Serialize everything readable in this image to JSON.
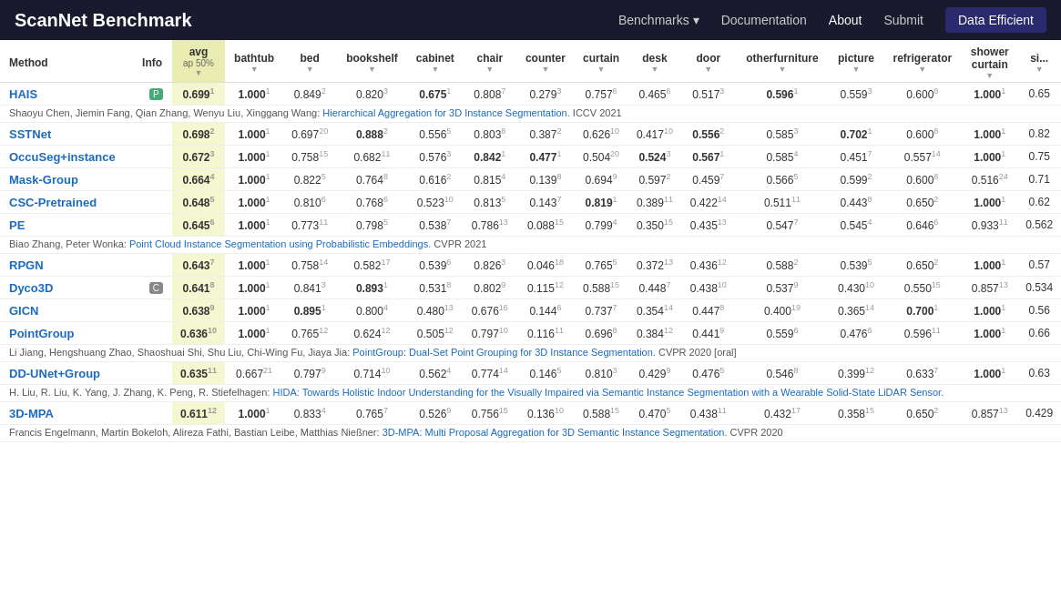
{
  "nav": {
    "title": "ScanNet Benchmark",
    "links": [
      {
        "label": "Benchmarks",
        "has_dropdown": true
      },
      {
        "label": "Documentation"
      },
      {
        "label": "About",
        "active": true
      },
      {
        "label": "Submit"
      },
      {
        "label": "Data Efficient",
        "special": true
      }
    ]
  },
  "table": {
    "columns": [
      {
        "key": "method",
        "label": "Method"
      },
      {
        "key": "info",
        "label": "Info"
      },
      {
        "key": "avg",
        "label": "avg",
        "sub": "ap 50%"
      },
      {
        "key": "bathtub",
        "label": "bathtub"
      },
      {
        "key": "bed",
        "label": "bed"
      },
      {
        "key": "bookshelf",
        "label": "bookshelf"
      },
      {
        "key": "cabinet",
        "label": "cabinet"
      },
      {
        "key": "chair",
        "label": "chair"
      },
      {
        "key": "counter",
        "label": "counter"
      },
      {
        "key": "curtain",
        "label": "curtain"
      },
      {
        "key": "desk",
        "label": "desk"
      },
      {
        "key": "door",
        "label": "door"
      },
      {
        "key": "otherfurniture",
        "label": "otherfurniture"
      },
      {
        "key": "picture",
        "label": "picture"
      },
      {
        "key": "refrigerator",
        "label": "refrigerator"
      },
      {
        "key": "shower_curtain",
        "label": "shower curtain"
      },
      {
        "key": "sink",
        "label": "si..."
      }
    ],
    "rows": [
      {
        "type": "data",
        "method": "HAIS",
        "badge": "P",
        "avg": "0.699",
        "avg_rank": "1",
        "bathtub": "1.000",
        "bathtub_rank": "1",
        "bathtub_bold": true,
        "bed": "0.849",
        "bed_rank": "2",
        "bookshelf": "0.820",
        "bookshelf_rank": "3",
        "cabinet": "0.675",
        "cabinet_rank": "1",
        "cabinet_bold": true,
        "chair": "0.808",
        "chair_rank": "7",
        "counter": "0.279",
        "counter_rank": "3",
        "curtain": "0.757",
        "curtain_rank": "6",
        "desk": "0.465",
        "desk_rank": "6",
        "door": "0.517",
        "door_rank": "3",
        "otherfurniture": "0.596",
        "otherfurniture_rank": "1",
        "otherfurniture_bold": true,
        "picture": "0.559",
        "picture_rank": "3",
        "refrigerator": "0.600",
        "refrigerator_rank": "8",
        "shower_curtain": "1.000",
        "shower_curtain_rank": "1",
        "shower_curtain_bold": true,
        "sink": "0.65"
      },
      {
        "type": "citation",
        "text": "Shaoyu Chen, Jiemin Fang, Qian Zhang, Wenyu Liu, Xinggang Wang: ",
        "link_text": "Hierarchical Aggregation for 3D Instance Segmentation.",
        "link_url": "#",
        "suffix": " ICCV 2021"
      },
      {
        "type": "data",
        "method": "SSTNet",
        "avg": "0.698",
        "avg_rank": "2",
        "bathtub": "1.000",
        "bathtub_rank": "1",
        "bathtub_bold": true,
        "bed": "0.697",
        "bed_rank": "20",
        "bookshelf": "0.888",
        "bookshelf_rank": "2",
        "bookshelf_bold": true,
        "cabinet": "0.556",
        "cabinet_rank": "5",
        "chair": "0.803",
        "chair_rank": "8",
        "counter": "0.387",
        "counter_rank": "2",
        "curtain": "0.626",
        "curtain_rank": "10",
        "desk": "0.417",
        "desk_rank": "10",
        "door": "0.556",
        "door_rank": "2",
        "door_bold": true,
        "otherfurniture": "0.585",
        "otherfurniture_rank": "3",
        "picture": "0.702",
        "picture_rank": "1",
        "picture_bold": true,
        "refrigerator": "0.600",
        "refrigerator_rank": "8",
        "shower_curtain": "1.000",
        "shower_curtain_rank": "1",
        "shower_curtain_bold": true,
        "sink": "0.82"
      },
      {
        "type": "data",
        "method": "OccuSeg+instance",
        "avg": "0.672",
        "avg_rank": "3",
        "bathtub": "1.000",
        "bathtub_rank": "1",
        "bathtub_bold": true,
        "bed": "0.758",
        "bed_rank": "15",
        "bookshelf": "0.682",
        "bookshelf_rank": "11",
        "cabinet": "0.576",
        "cabinet_rank": "3",
        "chair": "0.842",
        "chair_rank": "1",
        "chair_bold": true,
        "counter": "0.477",
        "counter_rank": "1",
        "counter_bold": true,
        "curtain": "0.504",
        "curtain_rank": "20",
        "desk": "0.524",
        "desk_rank": "3",
        "desk_bold": true,
        "door": "0.567",
        "door_rank": "1",
        "door_bold": true,
        "otherfurniture": "0.585",
        "otherfurniture_rank": "4",
        "picture": "0.451",
        "picture_rank": "7",
        "refrigerator": "0.557",
        "refrigerator_rank": "14",
        "shower_curtain": "1.000",
        "shower_curtain_rank": "1",
        "shower_curtain_bold": true,
        "sink": "0.75"
      },
      {
        "type": "data",
        "method": "Mask-Group",
        "avg": "0.664",
        "avg_rank": "4",
        "bathtub": "1.000",
        "bathtub_rank": "1",
        "bathtub_bold": true,
        "bed": "0.822",
        "bed_rank": "5",
        "bookshelf": "0.764",
        "bookshelf_rank": "8",
        "cabinet": "0.616",
        "cabinet_rank": "2",
        "chair": "0.815",
        "chair_rank": "4",
        "counter": "0.139",
        "counter_rank": "8",
        "curtain": "0.694",
        "curtain_rank": "9",
        "desk": "0.597",
        "desk_rank": "2",
        "door": "0.459",
        "door_rank": "7",
        "otherfurniture": "0.566",
        "otherfurniture_rank": "5",
        "picture": "0.599",
        "picture_rank": "2",
        "refrigerator": "0.600",
        "refrigerator_rank": "8",
        "shower_curtain": "0.516",
        "shower_curtain_rank": "24",
        "sink": "0.71"
      },
      {
        "type": "data",
        "method": "CSC-Pretrained",
        "avg": "0.648",
        "avg_rank": "5",
        "bathtub": "1.000",
        "bathtub_rank": "1",
        "bathtub_bold": true,
        "bed": "0.810",
        "bed_rank": "6",
        "bookshelf": "0.768",
        "bookshelf_rank": "6",
        "cabinet": "0.523",
        "cabinet_rank": "10",
        "chair": "0.813",
        "chair_rank": "5",
        "counter": "0.143",
        "counter_rank": "7",
        "curtain": "0.819",
        "curtain_rank": "1",
        "curtain_bold": true,
        "desk": "0.389",
        "desk_rank": "11",
        "door": "0.422",
        "door_rank": "14",
        "otherfurniture": "0.511",
        "otherfurniture_rank": "11",
        "picture": "0.443",
        "picture_rank": "8",
        "refrigerator": "0.650",
        "refrigerator_rank": "2",
        "shower_curtain": "1.000",
        "shower_curtain_rank": "1",
        "shower_curtain_bold": true,
        "sink": "0.62"
      },
      {
        "type": "data",
        "method": "PE",
        "avg": "0.645",
        "avg_rank": "6",
        "bathtub": "1.000",
        "bathtub_rank": "1",
        "bathtub_bold": true,
        "bed": "0.773",
        "bed_rank": "11",
        "bookshelf": "0.798",
        "bookshelf_rank": "5",
        "cabinet": "0.538",
        "cabinet_rank": "7",
        "chair": "0.786",
        "chair_rank": "13",
        "counter": "0.088",
        "counter_rank": "15",
        "curtain": "0.799",
        "curtain_rank": "4",
        "desk": "0.350",
        "desk_rank": "15",
        "door": "0.435",
        "door_rank": "13",
        "otherfurniture": "0.547",
        "otherfurniture_rank": "7",
        "picture": "0.545",
        "picture_rank": "4",
        "refrigerator": "0.646",
        "refrigerator_rank": "6",
        "shower_curtain": "0.933",
        "shower_curtain_rank": "11",
        "sink": "0.562"
      },
      {
        "type": "citation",
        "text": "Biao Zhang, Peter Wonka: ",
        "link_text": "Point Cloud Instance Segmentation using Probabilistic Embeddings.",
        "link_url": "#",
        "suffix": " CVPR 2021"
      },
      {
        "type": "data",
        "method": "RPGN",
        "avg": "0.643",
        "avg_rank": "7",
        "bathtub": "1.000",
        "bathtub_rank": "1",
        "bathtub_bold": true,
        "bed": "0.758",
        "bed_rank": "14",
        "bookshelf": "0.582",
        "bookshelf_rank": "17",
        "cabinet": "0.539",
        "cabinet_rank": "6",
        "chair": "0.826",
        "chair_rank": "3",
        "counter": "0.046",
        "counter_rank": "18",
        "curtain": "0.765",
        "curtain_rank": "5",
        "desk": "0.372",
        "desk_rank": "13",
        "door": "0.436",
        "door_rank": "12",
        "otherfurniture": "0.588",
        "otherfurniture_rank": "2",
        "picture": "0.539",
        "picture_rank": "5",
        "refrigerator": "0.650",
        "refrigerator_rank": "2",
        "shower_curtain": "1.000",
        "shower_curtain_rank": "1",
        "shower_curtain_bold": true,
        "sink": "0.57"
      },
      {
        "type": "data",
        "method": "Dyco3D",
        "badge": "C",
        "avg": "0.641",
        "avg_rank": "8",
        "bathtub": "1.000",
        "bathtub_rank": "1",
        "bathtub_bold": true,
        "bed": "0.841",
        "bed_rank": "3",
        "bookshelf": "0.893",
        "bookshelf_rank": "1",
        "bookshelf_bold": true,
        "cabinet": "0.531",
        "cabinet_rank": "8",
        "chair": "0.802",
        "chair_rank": "9",
        "counter": "0.115",
        "counter_rank": "12",
        "curtain": "0.588",
        "curtain_rank": "15",
        "desk": "0.448",
        "desk_rank": "7",
        "door": "0.438",
        "door_rank": "10",
        "otherfurniture": "0.537",
        "otherfurniture_rank": "9",
        "picture": "0.430",
        "picture_rank": "10",
        "refrigerator": "0.550",
        "refrigerator_rank": "15",
        "shower_curtain": "0.857",
        "shower_curtain_rank": "13",
        "sink": "0.534"
      },
      {
        "type": "data",
        "method": "GICN",
        "avg": "0.638",
        "avg_rank": "9",
        "bathtub": "1.000",
        "bathtub_rank": "1",
        "bathtub_bold": true,
        "bed": "0.895",
        "bed_rank": "1",
        "bed_bold": true,
        "bookshelf": "0.800",
        "bookshelf_rank": "4",
        "cabinet": "0.480",
        "cabinet_rank": "13",
        "chair": "0.676",
        "chair_rank": "16",
        "counter": "0.144",
        "counter_rank": "6",
        "curtain": "0.737",
        "curtain_rank": "7",
        "desk": "0.354",
        "desk_rank": "14",
        "door": "0.447",
        "door_rank": "8",
        "otherfurniture": "0.400",
        "otherfurniture_rank": "19",
        "picture": "0.365",
        "picture_rank": "14",
        "refrigerator": "0.700",
        "refrigerator_rank": "1",
        "refrigerator_bold": true,
        "shower_curtain": "1.000",
        "shower_curtain_rank": "1",
        "shower_curtain_bold": true,
        "sink": "0.56"
      },
      {
        "type": "data",
        "method": "PointGroup",
        "avg": "0.636",
        "avg_rank": "10",
        "bathtub": "1.000",
        "bathtub_rank": "1",
        "bathtub_bold": true,
        "bed": "0.765",
        "bed_rank": "12",
        "bookshelf": "0.624",
        "bookshelf_rank": "12",
        "cabinet": "0.505",
        "cabinet_rank": "12",
        "chair": "0.797",
        "chair_rank": "10",
        "counter": "0.116",
        "counter_rank": "11",
        "curtain": "0.696",
        "curtain_rank": "8",
        "desk": "0.384",
        "desk_rank": "12",
        "door": "0.441",
        "door_rank": "9",
        "otherfurniture": "0.559",
        "otherfurniture_rank": "6",
        "picture": "0.476",
        "picture_rank": "6",
        "refrigerator": "0.596",
        "refrigerator_rank": "11",
        "shower_curtain": "1.000",
        "shower_curtain_rank": "1",
        "shower_curtain_bold": true,
        "sink": "0.66"
      },
      {
        "type": "citation",
        "text": "Li Jiang, Hengshuang Zhao, Shaoshuai Shi, Shu Liu, Chi-Wing Fu, Jiaya Jia: ",
        "link_text": "PointGroup: Dual-Set Point Grouping for 3D Instance Segmentation.",
        "link_url": "#",
        "suffix": " CVPR 2020 [oral]"
      },
      {
        "type": "data",
        "method": "DD-UNet+Group",
        "avg": "0.635",
        "avg_rank": "11",
        "bathtub": "0.667",
        "bathtub_rank": "21",
        "bed": "0.797",
        "bed_rank": "9",
        "bookshelf": "0.714",
        "bookshelf_rank": "10",
        "cabinet": "0.562",
        "cabinet_rank": "4",
        "chair": "0.774",
        "chair_rank": "14",
        "counter": "0.146",
        "counter_rank": "5",
        "curtain": "0.810",
        "curtain_rank": "3",
        "desk": "0.429",
        "desk_rank": "9",
        "door": "0.476",
        "door_rank": "5",
        "otherfurniture": "0.546",
        "otherfurniture_rank": "8",
        "picture": "0.399",
        "picture_rank": "12",
        "refrigerator": "0.633",
        "refrigerator_rank": "7",
        "shower_curtain": "1.000",
        "shower_curtain_rank": "1",
        "shower_curtain_bold": true,
        "sink": "0.63"
      },
      {
        "type": "citation",
        "text": "H. Liu, R. Liu, K. Yang, J. Zhang, K. Peng, R. Stiefelhagen: ",
        "link_text": "HIDA: Towards Holistic Indoor Understanding for the Visually Impaired via Semantic Instance Segmentation with a Wearable Solid-State LiDAR Sensor.",
        "link_url": "#",
        "suffix": ""
      },
      {
        "type": "data",
        "method": "3D-MPA",
        "avg": "0.611",
        "avg_rank": "12",
        "bathtub": "1.000",
        "bathtub_rank": "1",
        "bathtub_bold": true,
        "bed": "0.833",
        "bed_rank": "4",
        "bookshelf": "0.765",
        "bookshelf_rank": "7",
        "cabinet": "0.526",
        "cabinet_rank": "9",
        "chair": "0.756",
        "chair_rank": "15",
        "counter": "0.136",
        "counter_rank": "10",
        "curtain": "0.588",
        "curtain_rank": "15",
        "desk": "0.470",
        "desk_rank": "5",
        "door": "0.438",
        "door_rank": "11",
        "otherfurniture": "0.432",
        "otherfurniture_rank": "17",
        "picture": "0.358",
        "picture_rank": "15",
        "refrigerator": "0.650",
        "refrigerator_rank": "2",
        "shower_curtain": "0.857",
        "shower_curtain_rank": "13",
        "sink": "0.429"
      },
      {
        "type": "citation",
        "text": "Francis Engelmann, Martin Bokeloh, Alireza Fathi, Bastian Leibe, Matthias Nießner: ",
        "link_text": "3D-MPA: Multi Proposal Aggregation for 3D Semantic Instance Segmentation.",
        "link_url": "#",
        "suffix": " CVPR 2020"
      }
    ]
  }
}
